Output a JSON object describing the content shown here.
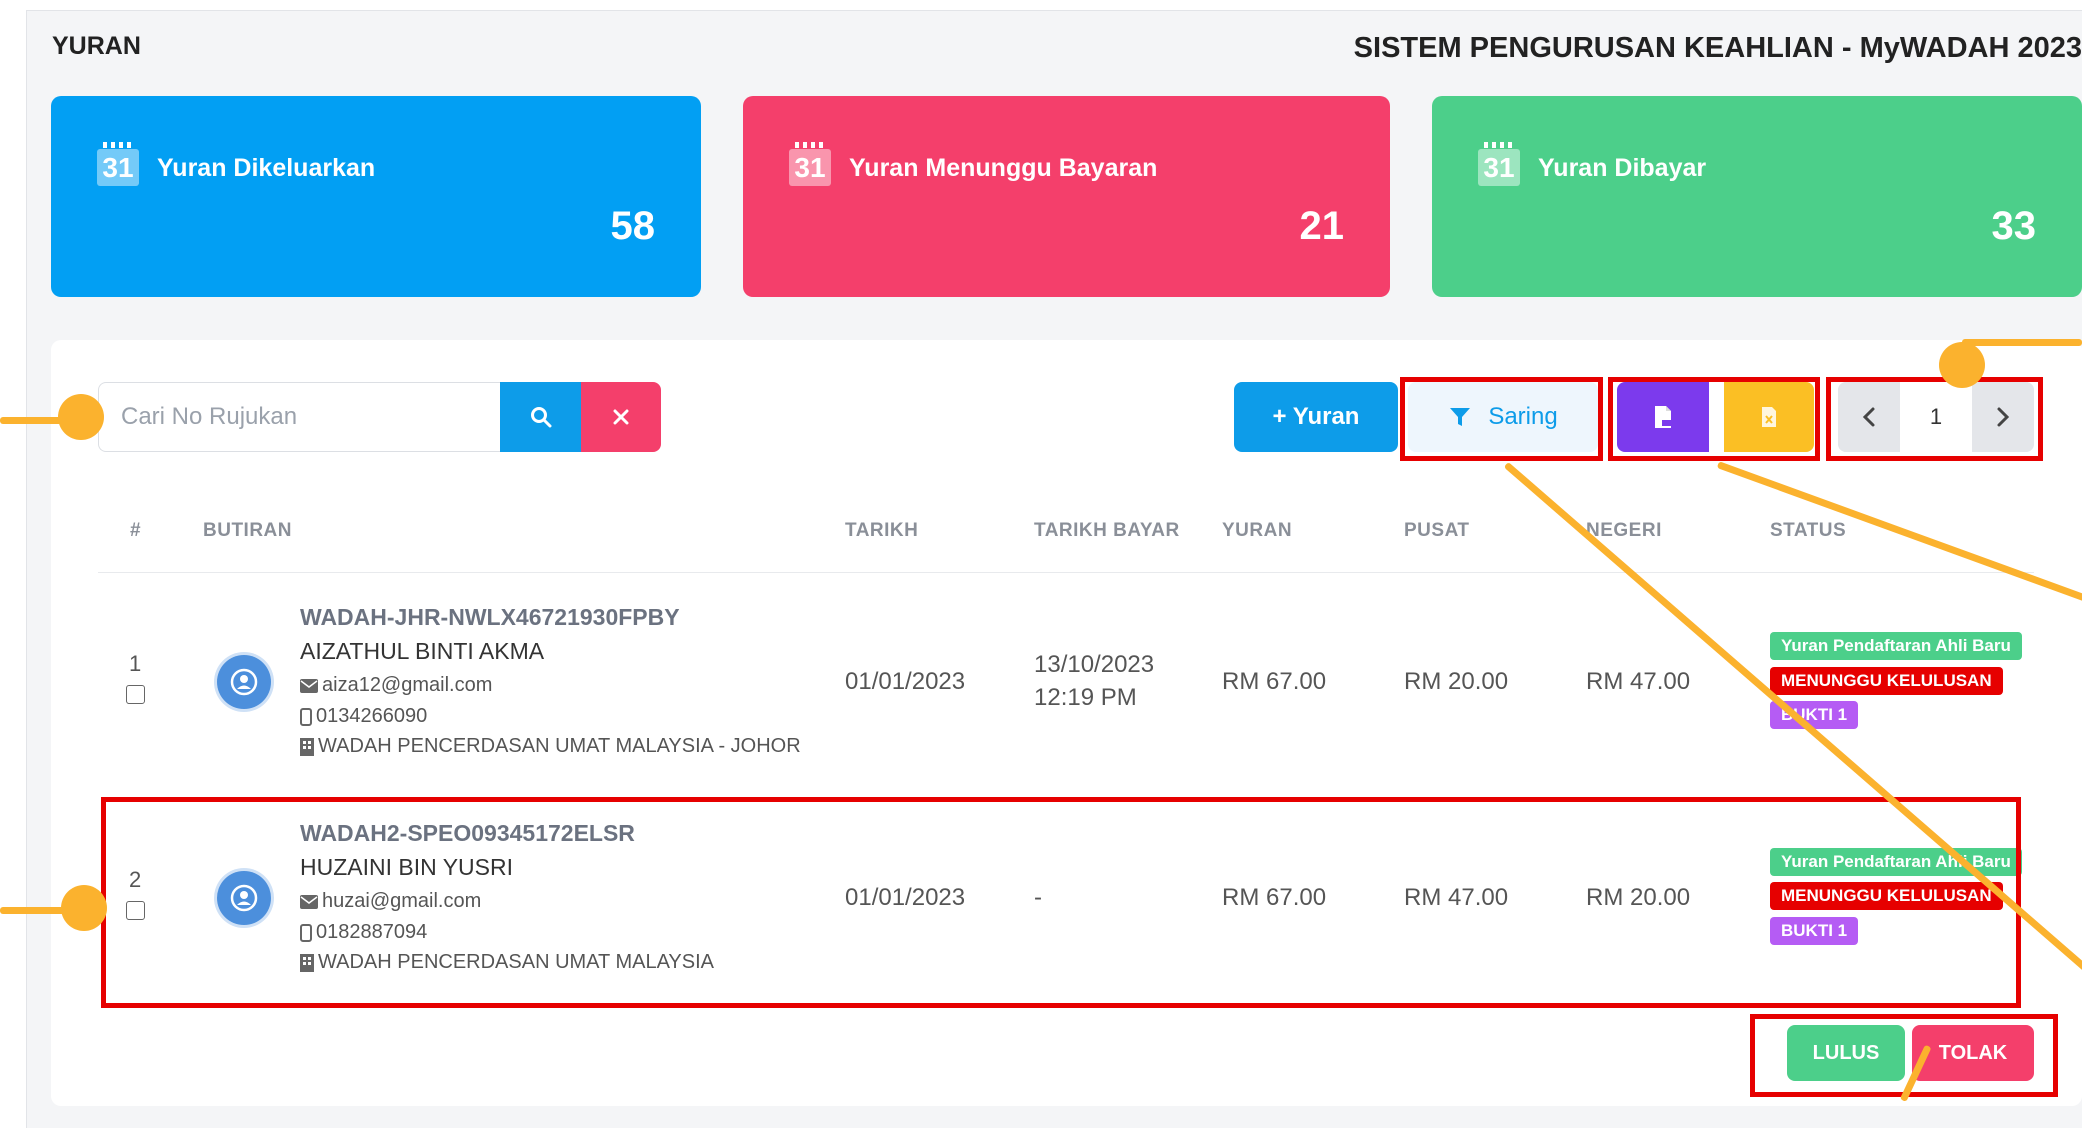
{
  "header": {
    "page_title": "YURAN",
    "app_title": "SISTEM PENGURUSAN KEAHLIAN - MyWADAH 2023"
  },
  "stats": [
    {
      "icon": "calendar-icon",
      "day": "31",
      "label": "Yuran Dikeluarkan",
      "value": "58",
      "color": "#029ff3"
    },
    {
      "icon": "calendar-icon",
      "day": "31",
      "label": "Yuran Menunggu Bayaran",
      "value": "21",
      "color": "#f43f6b"
    },
    {
      "icon": "calendar-icon",
      "day": "31",
      "label": "Yuran Dibayar",
      "value": "33",
      "color": "#4ccf8a"
    }
  ],
  "toolbar": {
    "search_placeholder": "Cari No Rujukan",
    "search_icon": "search-icon",
    "clear_icon": "close-icon",
    "add_label": "+ Yuran",
    "filter_label": "Saring",
    "filter_icon": "filter-icon",
    "pdf_icon": "pdf-file-icon",
    "excel_icon": "excel-file-icon",
    "page": "1"
  },
  "table": {
    "headers": [
      "#",
      "BUTIRAN",
      "TARIKH",
      "TARIKH BAYAR",
      "YURAN",
      "PUSAT",
      "NEGERI",
      "STATUS"
    ],
    "rows": [
      {
        "num": "1",
        "ref": "WADAH-JHR-NWLX46721930FPBY",
        "name": "AIZATHUL BINTI AKMA",
        "email": "aiza12@gmail.com",
        "phone": "0134266090",
        "org": "WADAH PENCERDASAN UMAT MALAYSIA - JOHOR",
        "tarikh": "01/01/2023",
        "tarikh_bayar_date": "13/10/2023",
        "tarikh_bayar_time": "12:19 PM",
        "yuran": "RM 67.00",
        "pusat": "RM 20.00",
        "negeri": "RM 47.00",
        "status": [
          "Yuran Pendaftaran Ahli Baru",
          "MENUNGGU KELULUSAN",
          "BUKTI 1"
        ]
      },
      {
        "num": "2",
        "ref": "WADAH2-SPEO09345172ELSR",
        "name": "HUZAINI BIN YUSRI",
        "email": "huzai@gmail.com",
        "phone": "0182887094",
        "org": "WADAH PENCERDASAN UMAT MALAYSIA",
        "tarikh": "01/01/2023",
        "tarikh_bayar_date": "-",
        "tarikh_bayar_time": "",
        "yuran": "RM 67.00",
        "pusat": "RM 47.00",
        "negeri": "RM 20.00",
        "status": [
          "Yuran Pendaftaran Ahli Baru",
          "MENUNGGU KELULUSAN",
          "BUKTI 1"
        ]
      }
    ]
  },
  "actions": {
    "approve_label": "LULUS",
    "reject_label": "TOLAK"
  },
  "colors": {
    "primary": "#0d9ce9",
    "danger": "#f43f6b",
    "success": "#4ccf8a",
    "purple": "#7c3aed",
    "yellow": "#fbbf24",
    "annotation_box": "#e60000",
    "annotation_callout": "#fbb22e"
  }
}
